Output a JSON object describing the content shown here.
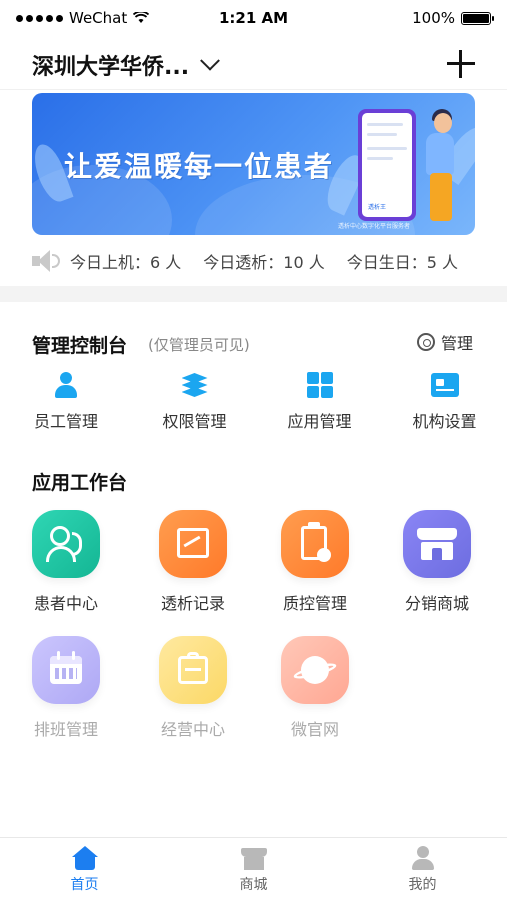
{
  "status_bar": {
    "carrier": "WeChat",
    "time": "1:21 AM",
    "battery": "100%"
  },
  "header": {
    "org_title": "深圳大学华侨..."
  },
  "banner": {
    "headline": "让爱温暖每一位患者",
    "caption": "透析中心数字化平台服务者",
    "phone_logo": "透析王"
  },
  "notice": {
    "stats": [
      {
        "label": "今日上机：6 人"
      },
      {
        "label": "今日透析：10 人"
      },
      {
        "label": "今日生日：5 人"
      }
    ]
  },
  "admin": {
    "title": "管理控制台",
    "note": "(仅管理员可见)",
    "manage_label": "管理",
    "items": [
      {
        "label": "员工管理",
        "icon": "staff-icon"
      },
      {
        "label": "权限管理",
        "icon": "layers-icon"
      },
      {
        "label": "应用管理",
        "icon": "apps-grid-icon"
      },
      {
        "label": "机构设置",
        "icon": "org-card-icon"
      }
    ]
  },
  "apps": {
    "title": "应用工作台",
    "items": [
      {
        "label": "患者中心",
        "icon": "patients-icon",
        "color": "#19c6a5"
      },
      {
        "label": "透析记录",
        "icon": "chart-icon",
        "color": "#ff8a3d"
      },
      {
        "label": "质控管理",
        "icon": "clipboard-icon",
        "color": "#ff8a3d"
      },
      {
        "label": "分销商城",
        "icon": "store-icon",
        "color": "#7b74f0"
      },
      {
        "label": "排班管理",
        "icon": "calendar-icon",
        "color": "#bdb7fb"
      },
      {
        "label": "经营中心",
        "icon": "briefcase-icon",
        "color": "#fde28a"
      },
      {
        "label": "微官网",
        "icon": "planet-icon",
        "color": "#ffb9a8"
      }
    ]
  },
  "tabbar": {
    "tabs": [
      {
        "label": "首页",
        "icon": "home-icon",
        "active": true
      },
      {
        "label": "商城",
        "icon": "shop-icon",
        "active": false
      },
      {
        "label": "我的",
        "icon": "user-icon",
        "active": false
      }
    ]
  },
  "colors": {
    "accent": "#1c7ef0",
    "icon_blue": "#1ba6f0"
  }
}
